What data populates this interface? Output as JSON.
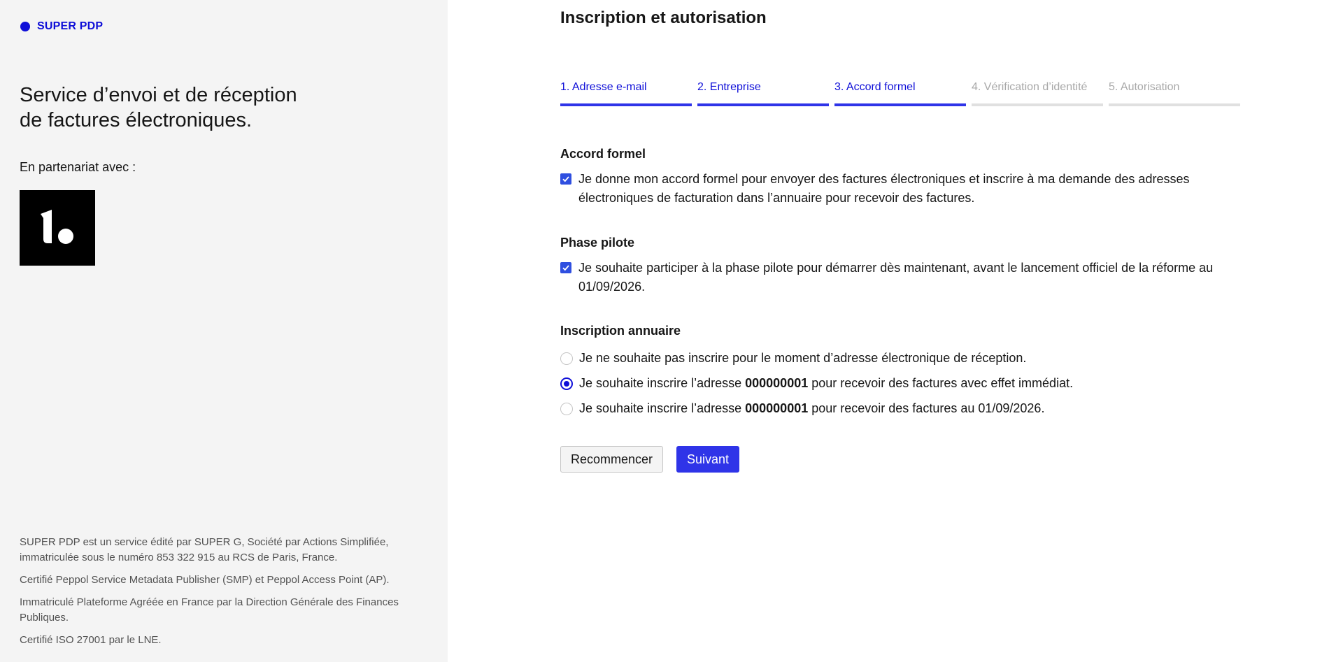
{
  "sidebar": {
    "brand": "SUPER PDP",
    "tagline": "Service d’envoi et de réception de factures électroniques.",
    "partner_label": "En partenariat avec :",
    "footer": [
      "SUPER PDP est un service édité par SUPER G, Société par Actions Simplifiée, immatriculée sous le numéro 853 322 915 au RCS de Paris, France.",
      "Certifié Peppol Service Metadata Publisher (SMP) et Peppol Access Point (AP).",
      "Immatriculé Plateforme Agréée en France par la Direction Générale des Finances Publiques.",
      "Certifié ISO 27001 par le LNE."
    ]
  },
  "main": {
    "title": "Inscription et autorisation",
    "steps": [
      {
        "label": "1. Adresse e-mail",
        "state": "complete"
      },
      {
        "label": "2. Entreprise",
        "state": "complete"
      },
      {
        "label": "3. Accord formel",
        "state": "current"
      },
      {
        "label": "4. Vérification d’identité",
        "state": "upcoming"
      },
      {
        "label": "5. Autorisation",
        "state": "upcoming"
      }
    ],
    "accord": {
      "title": "Accord formel",
      "checkbox_label": "Je donne mon accord formel pour envoyer des factures électroniques et inscrire à ma demande des adresses électroniques de facturation dans l’annuaire pour recevoir des factures.",
      "checked": true
    },
    "pilote": {
      "title": "Phase pilote",
      "checkbox_label": "Je souhaite participer à la phase pilote pour démarrer dès maintenant, avant le lancement officiel de la réforme au 01/09/2026.",
      "checked": true
    },
    "annuaire": {
      "title": "Inscription annuaire",
      "options": [
        {
          "pre": "Je ne souhaite pas inscrire pour le moment d’adresse électronique de réception.",
          "bold": "",
          "post": "",
          "selected": false
        },
        {
          "pre": "Je souhaite inscrire l’adresse ",
          "bold": "000000001",
          "post": " pour recevoir des factures avec effet immédiat.",
          "selected": true
        },
        {
          "pre": "Je souhaite inscrire l’adresse ",
          "bold": "000000001",
          "post": " pour recevoir des factures au 01/09/2026.",
          "selected": false
        }
      ]
    },
    "buttons": {
      "restart": "Recommencer",
      "next": "Suivant"
    }
  },
  "colors": {
    "accent": "#2f34e8",
    "brand": "#0f0fd8",
    "inactive_step": "#a8a8a8",
    "sidebar_bg": "#f4f4f4"
  }
}
